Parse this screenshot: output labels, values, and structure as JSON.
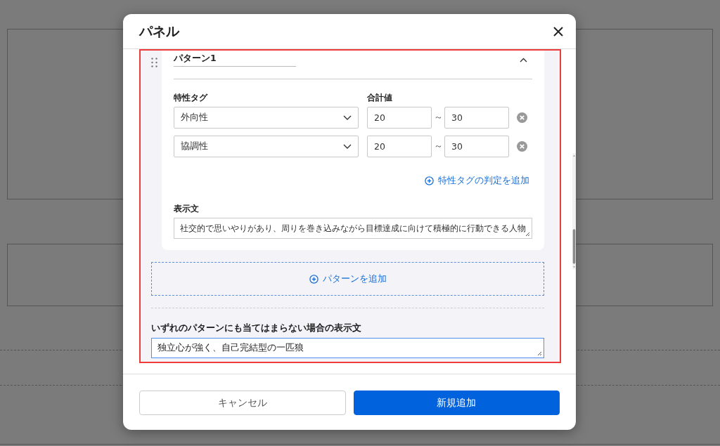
{
  "dialog": {
    "title": "パネル"
  },
  "patterns": [
    {
      "name": "パターン1",
      "expanded": true,
      "tag_header": "特性タグ",
      "total_header": "合計値",
      "rules": [
        {
          "tag": "外向性",
          "min": "20",
          "separator": "～",
          "max": "30"
        },
        {
          "tag": "協調性",
          "min": "20",
          "separator": "～",
          "max": "30"
        }
      ],
      "add_rule": "特性タグの判定を追加",
      "text_label": "表示文",
      "text": "社交的で思いやりがあり、周りを巻き込みながら目標達成に向けて積極的に行動できる人物"
    }
  ],
  "add_pattern": "パターンを追加",
  "fallback": {
    "label": "いずれのパターンにも当てはまらない場合の表示文",
    "value": "独立心が強く、自己完結型の一匹狼",
    "focused": true
  },
  "buttons": [
    {
      "label": "キャンセル",
      "kind": "secondary"
    },
    {
      "label": "新規追加",
      "kind": "primary"
    }
  ]
}
